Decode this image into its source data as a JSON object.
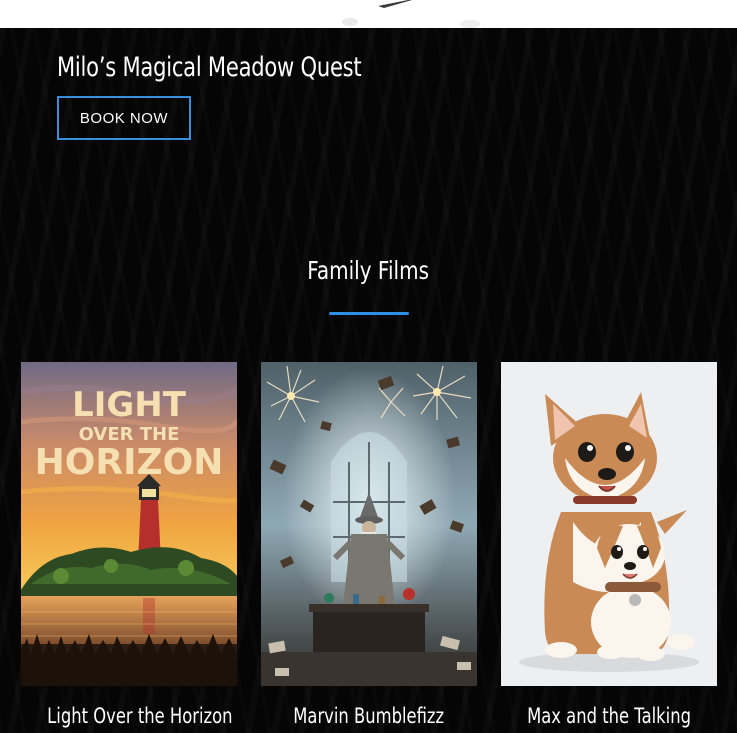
{
  "feature": {
    "title": "Milo’s Magical Meadow Quest",
    "cta_label": "BOOK NOW"
  },
  "section": {
    "title": "Family Films",
    "accent_color": "#2f8ee6"
  },
  "films": [
    {
      "title": "Light Over the Horizon",
      "poster_text": [
        "LIGHT",
        "OVER THE",
        "HORIZON"
      ],
      "poster_icon": "lighthouse-poster"
    },
    {
      "title": "Marvin Bumblefizz",
      "poster_icon": "wizard-poster"
    },
    {
      "title": "Max and the Talking",
      "poster_icon": "dogs-poster"
    }
  ]
}
